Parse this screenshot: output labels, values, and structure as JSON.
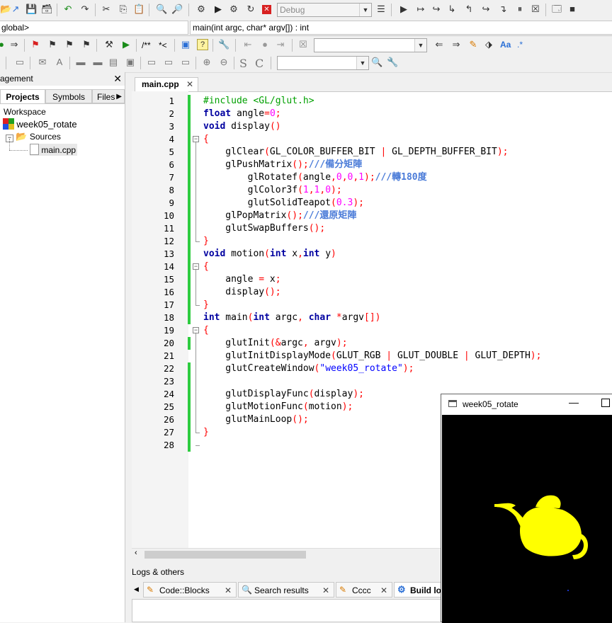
{
  "toolbar1": {
    "build_target": "Debug"
  },
  "toolbar2": {
    "scope": "global>",
    "function": "main(int argc, char* argv[]) : int"
  },
  "toolbar3": {
    "comment_block": "/**",
    "comment_line": "*<",
    "case_match": "Aa",
    "regex": ".*"
  },
  "toolbar4": {
    "S_label": "S",
    "C_label": "C"
  },
  "left_panel": {
    "title": "agement",
    "tabs": [
      "Projects",
      "Symbols",
      "Files"
    ],
    "workspace": "Workspace",
    "project": "week05_rotate",
    "folder": "Sources",
    "file": "main.cpp"
  },
  "editor": {
    "tab_label": "main.cpp",
    "line_numbers": [
      "1",
      "2",
      "3",
      "4",
      "5",
      "6",
      "7",
      "8",
      "9",
      "10",
      "11",
      "12",
      "13",
      "14",
      "15",
      "16",
      "17",
      "18",
      "19",
      "20",
      "21",
      "22",
      "23",
      "24",
      "25",
      "26",
      "27",
      "28"
    ]
  },
  "logs": {
    "title": "Logs & others",
    "tabs": [
      "Code::Blocks",
      "Search results",
      "Cccc",
      "Build lo"
    ]
  },
  "glut_window": {
    "title": "week05_rotate"
  },
  "colors": {
    "changed_line": "#2ecc40",
    "teapot": "#ffff00",
    "canvas": "#000000"
  }
}
